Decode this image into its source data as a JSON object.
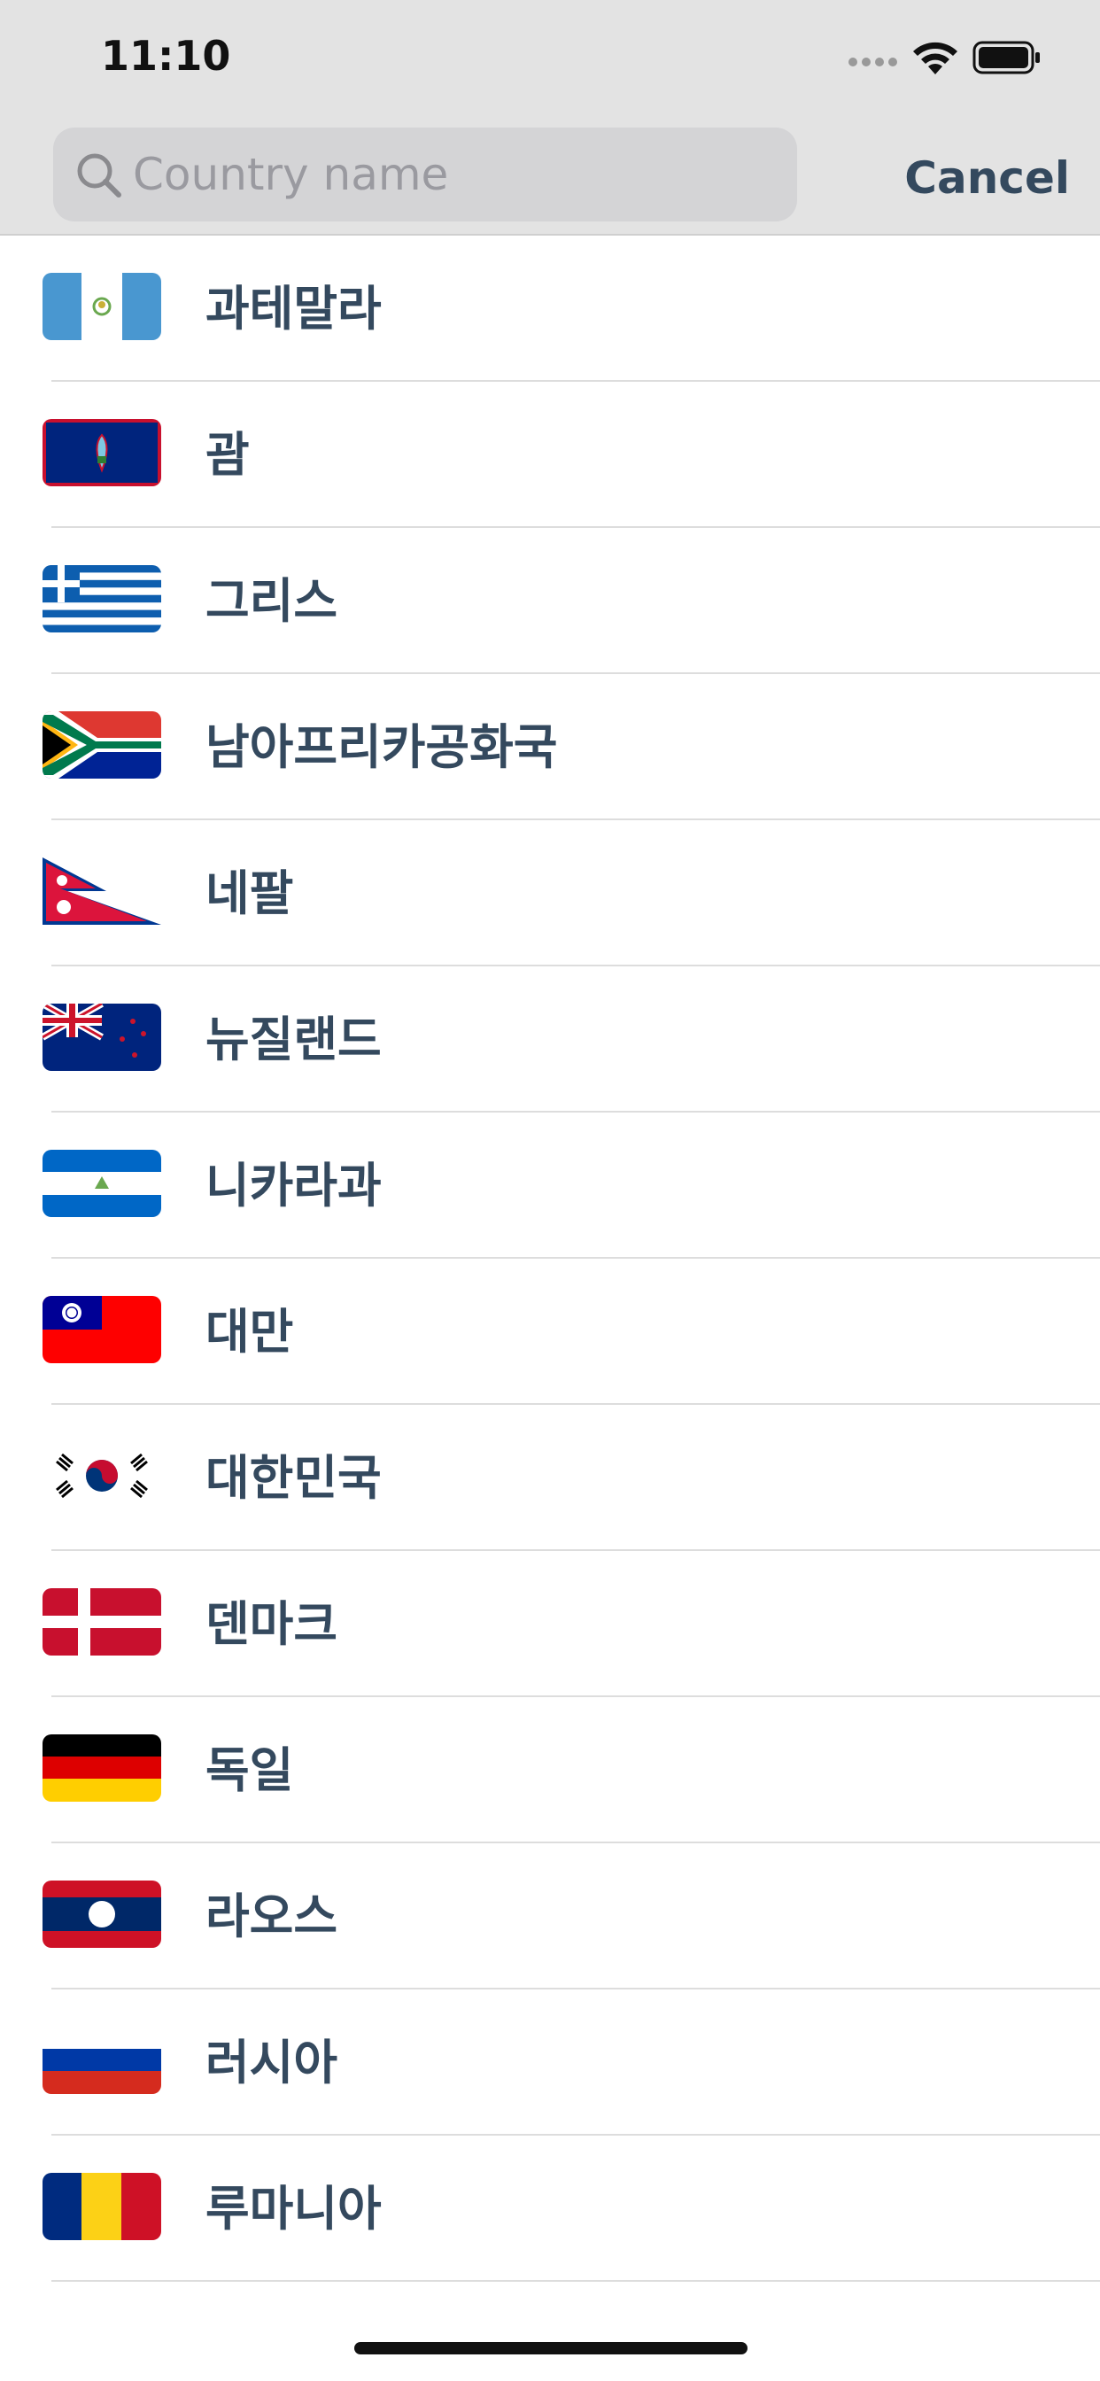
{
  "status_bar": {
    "time": "11:10",
    "icons": [
      "signal-dots-icon",
      "wifi-icon",
      "battery-icon"
    ]
  },
  "search": {
    "placeholder": "Country name",
    "value": "",
    "icon": "search-icon"
  },
  "cancel_label": "Cancel",
  "countries": [
    {
      "name": "과테말라",
      "flag": "guatemala-flag-icon"
    },
    {
      "name": "괌",
      "flag": "guam-flag-icon"
    },
    {
      "name": "그리스",
      "flag": "greece-flag-icon"
    },
    {
      "name": "남아프리카공화국",
      "flag": "south-africa-flag-icon"
    },
    {
      "name": "네팔",
      "flag": "nepal-flag-icon"
    },
    {
      "name": "뉴질랜드",
      "flag": "new-zealand-flag-icon"
    },
    {
      "name": "니카라과",
      "flag": "nicaragua-flag-icon"
    },
    {
      "name": "대만",
      "flag": "taiwan-flag-icon"
    },
    {
      "name": "대한민국",
      "flag": "south-korea-flag-icon"
    },
    {
      "name": "덴마크",
      "flag": "denmark-flag-icon"
    },
    {
      "name": "독일",
      "flag": "germany-flag-icon"
    },
    {
      "name": "라오스",
      "flag": "laos-flag-icon"
    },
    {
      "name": "러시아",
      "flag": "russia-flag-icon"
    },
    {
      "name": "루마니아",
      "flag": "romania-flag-icon"
    }
  ],
  "colors": {
    "header_bg": "#e3e3e3",
    "search_bg": "#d4d4d6",
    "text": "#34495e",
    "separator": "#dddddd"
  }
}
